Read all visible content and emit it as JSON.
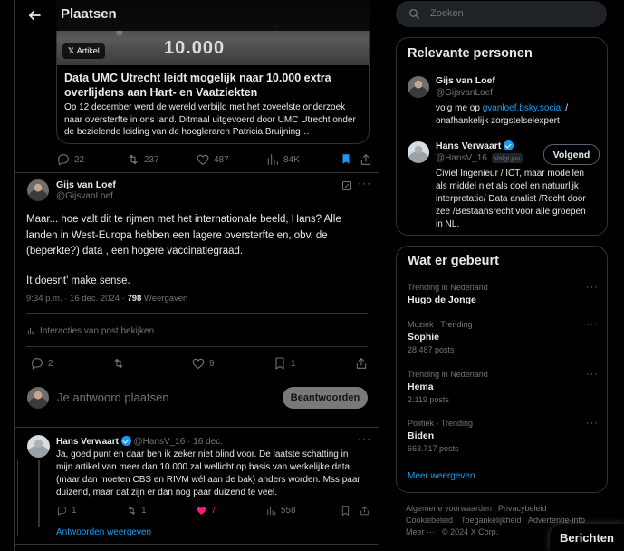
{
  "header": {
    "title": "Plaatsen"
  },
  "quoted_article": {
    "badge": "Artikel",
    "image_text": "10.000",
    "title": "Data UMC Utrecht leidt mogelijk naar 10.000 extra overlijdens aan Hart- en Vaatziekten",
    "description": "Op 12 december werd de wereld verbijld met het zoveelste onderzoek naar oversterfte in ons land. Ditmaal uitgevoerd door UMC Utrecht onder de bezielende leiding van de hoogleraren Patricia Bruijning…"
  },
  "parent_actions": {
    "replies": "22",
    "reposts": "237",
    "likes": "487",
    "views": "84K"
  },
  "post": {
    "author": "Gijs van Loef",
    "handle": "@GijsvanLoef",
    "text_lines": [
      "Maar... hoe valt dit te rijmen met het internationale beeld, Hans? Alle",
      "landen in  West-Europa hebben een lagere oversterfte en, obv. de",
      "(beperkte?) data , een hogere vaccinatiegraad."
    ],
    "text2": "It doesnt' make sense.",
    "time": "9:34 p.m. · 16 dec. 2024 · ",
    "views": "798",
    "views_label": " Weergaven",
    "interactions": "Interacties van post bekijken",
    "replies": "2",
    "likes": "9",
    "bookmarks": "1"
  },
  "reply_box": {
    "placeholder": "Je antwoord plaatsen",
    "button": "Beantwoorden"
  },
  "reply": {
    "author": "Hans Verwaart",
    "handle_time": "@HansV_16 · 16 dec.",
    "text_lines": [
      "Ja, goed punt en daar ben ik zeker niet blind voor. De laatste schatting in",
      "mijn artikel van meer dan 10.000 zal wellicht op basis van werkelijke data",
      "(maar dan moeten CBS en RIVM wél aan de bak) anders worden. Mss paar",
      "duizend, maar dat zijn er dan nog paar duizend te veel."
    ],
    "replies": "1",
    "reposts": "1",
    "likes": "7",
    "views": "558",
    "show_replies": "Antwoorden weergeven"
  },
  "search": {
    "placeholder": "Zoeken"
  },
  "relevant": {
    "heading": "Relevante personen",
    "p1": {
      "name": "Gijs van Loef",
      "handle": "@GijsvanLoef",
      "bio_pre": "volg me op ",
      "bio_link": "gvanloef.bsky.social",
      "bio_post": " /",
      "bio_line2": "onafhankelijk zorgstelselexpert"
    },
    "p2": {
      "name": "Hans Verwaart",
      "handle": "@HansV_16",
      "follows_you": "Volgt jou",
      "button": "Volgend",
      "bio_lines": [
        "Civiel Ingenieur / ICT, maar modellen",
        "als middel niet als doel en natuurlijk",
        "interpretatie/ Data analist /Recht door",
        "zee /Bestaansrecht voor alle groepen",
        "in NL."
      ]
    }
  },
  "trends": {
    "heading": "Wat er gebeurt",
    "items": [
      {
        "category": "Trending in Nederland",
        "name": "Hugo de Jonge",
        "count": ""
      },
      {
        "category": "Muziek · Trending",
        "name": "Sophie",
        "count": "28.487 posts"
      },
      {
        "category": "Trending in Nederland",
        "name": "Hema",
        "count": "2.119 posts"
      },
      {
        "category": "Politiek · Trending",
        "name": "Biden",
        "count": "663.717 posts"
      }
    ],
    "more": "Meer weergeven"
  },
  "footer": {
    "l1a": "Algemene voorwaarden",
    "l1b": "Privacybeleid",
    "l2a": "Cookiebeleid",
    "l2b": "Toegankelijkheid",
    "l2c": "Advertentie-info",
    "l3a": "Meer ···",
    "l3b": "© 2024 X Corp."
  },
  "messages": {
    "label": "Berichten"
  },
  "colors": {
    "accent": "#1d9bf0",
    "like": "#f91880",
    "background": "#000000"
  }
}
